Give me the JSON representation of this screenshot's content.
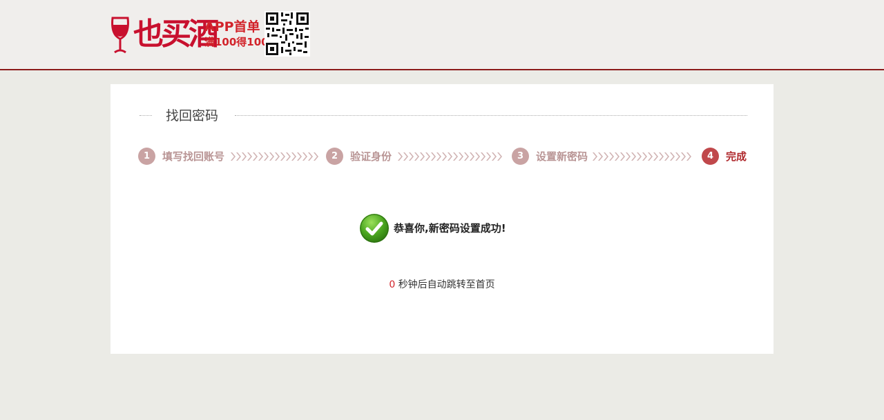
{
  "header": {
    "logo_text": "也买酒",
    "promo_line1": "APP首单",
    "promo_line2": "满100得100",
    "qr_icon": "qr-code-icon",
    "brand_color": "#c8102e"
  },
  "card": {
    "title": "找回密码",
    "steps": [
      {
        "number": "1",
        "label": "填写找回账号",
        "active": false
      },
      {
        "number": "2",
        "label": "验证身份",
        "active": false
      },
      {
        "number": "3",
        "label": "设置新密码",
        "active": false
      },
      {
        "number": "4",
        "label": "完成",
        "active": true
      }
    ],
    "success_icon": "check-circle-icon",
    "success_message": "恭喜你,新密码设置成功!",
    "countdown": "0",
    "redirect_text": "秒钟后自动跳转至首页"
  },
  "colors": {
    "active_step": "#c0484b",
    "inactive_step": "#c9a3a3",
    "header_border": "#8b1a1a",
    "success_green": "#5fb52a"
  }
}
